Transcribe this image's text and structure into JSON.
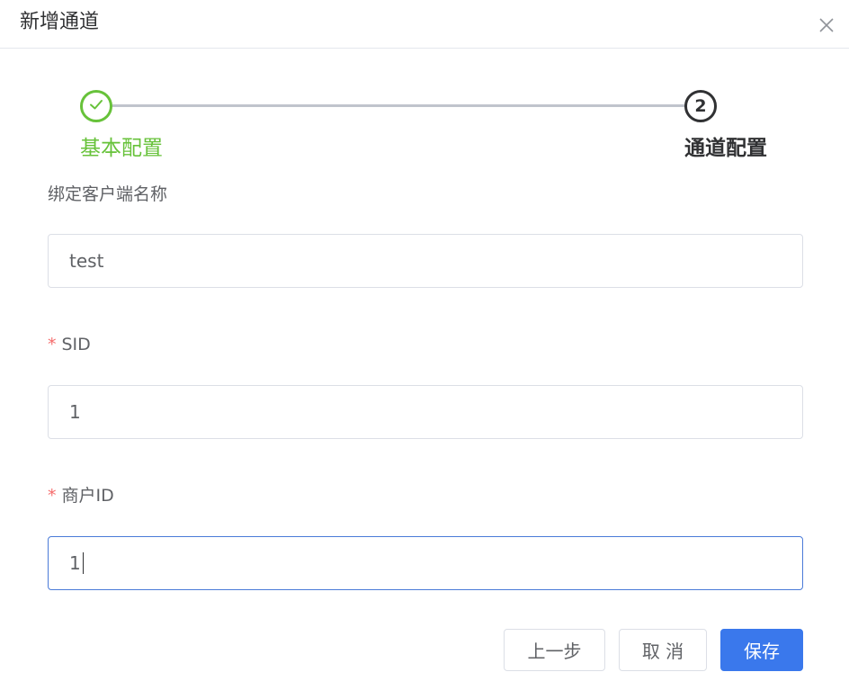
{
  "dialog": {
    "title": "新增通道"
  },
  "steps": [
    {
      "label": "基本配置",
      "status": "finished"
    },
    {
      "label": "通道配置",
      "number": "2",
      "status": "active"
    }
  ],
  "form": {
    "client_name": {
      "label": "绑定客户端名称",
      "value": "test",
      "required": false
    },
    "sid": {
      "label": "SID",
      "value": "1",
      "required": true
    },
    "merchant_id": {
      "label": "商户ID",
      "value": "1",
      "required": true
    }
  },
  "buttons": {
    "prev": "上一步",
    "cancel": "取 消",
    "save": "保存"
  },
  "colors": {
    "success": "#67c23a",
    "primary": "#3a78ec",
    "required": "#f56c6c"
  },
  "icons": {
    "close": "close-icon",
    "step_done": "check-icon"
  }
}
